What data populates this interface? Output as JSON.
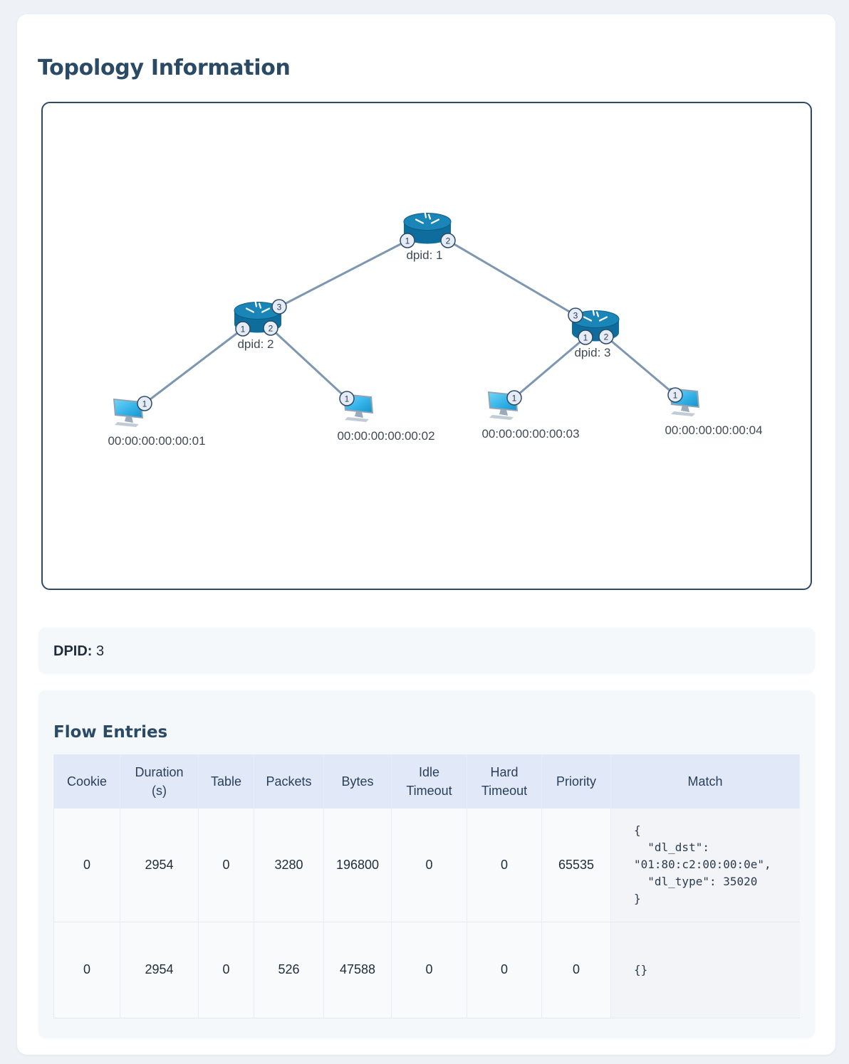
{
  "page": {
    "title": "Topology Information"
  },
  "topology": {
    "switches": [
      {
        "id": "s1",
        "label": "dpid: 1",
        "ports": [
          "1",
          "2"
        ]
      },
      {
        "id": "s2",
        "label": "dpid: 2",
        "ports": [
          "1",
          "2",
          "3"
        ]
      },
      {
        "id": "s3",
        "label": "dpid: 3",
        "ports": [
          "1",
          "2",
          "3"
        ]
      }
    ],
    "hosts": [
      {
        "id": "h1",
        "label": "00:00:00:00:00:01",
        "port": "1"
      },
      {
        "id": "h2",
        "label": "00:00:00:00:00:02",
        "port": "1"
      },
      {
        "id": "h3",
        "label": "00:00:00:00:00:03",
        "port": "1"
      },
      {
        "id": "h4",
        "label": "00:00:00:00:00:04",
        "port": "1"
      }
    ],
    "links": [
      [
        "s1:1",
        "s2:3"
      ],
      [
        "s1:2",
        "s3:3"
      ],
      [
        "s2:1",
        "h1:1"
      ],
      [
        "s2:2",
        "h2:1"
      ],
      [
        "s3:1",
        "h3:1"
      ],
      [
        "s3:2",
        "h4:1"
      ]
    ],
    "colors": {
      "link": "#7d97b0",
      "switch": "#0e6d9c",
      "switch_top": "#1a86b8",
      "port_fill": "#e6ecf7",
      "port_stroke": "#2e4a63",
      "host_screen": "#34b3e8"
    }
  },
  "dpid": {
    "label": "DPID:",
    "value": "3"
  },
  "flow_entries": {
    "title": "Flow Entries",
    "columns": [
      "Cookie",
      "Duration (s)",
      "Table",
      "Packets",
      "Bytes",
      "Idle Timeout",
      "Hard Timeout",
      "Priority",
      "Match"
    ],
    "rows": [
      {
        "cookie": "0",
        "duration": "2954",
        "table": "0",
        "packets": "3280",
        "bytes": "196800",
        "idle_timeout": "0",
        "hard_timeout": "0",
        "priority": "65535",
        "match": "{\n  \"dl_dst\":\n\"01:80:c2:00:00:0e\",\n  \"dl_type\": 35020\n}"
      },
      {
        "cookie": "0",
        "duration": "2954",
        "table": "0",
        "packets": "526",
        "bytes": "47588",
        "idle_timeout": "0",
        "hard_timeout": "0",
        "priority": "0",
        "match": "{}"
      }
    ]
  }
}
